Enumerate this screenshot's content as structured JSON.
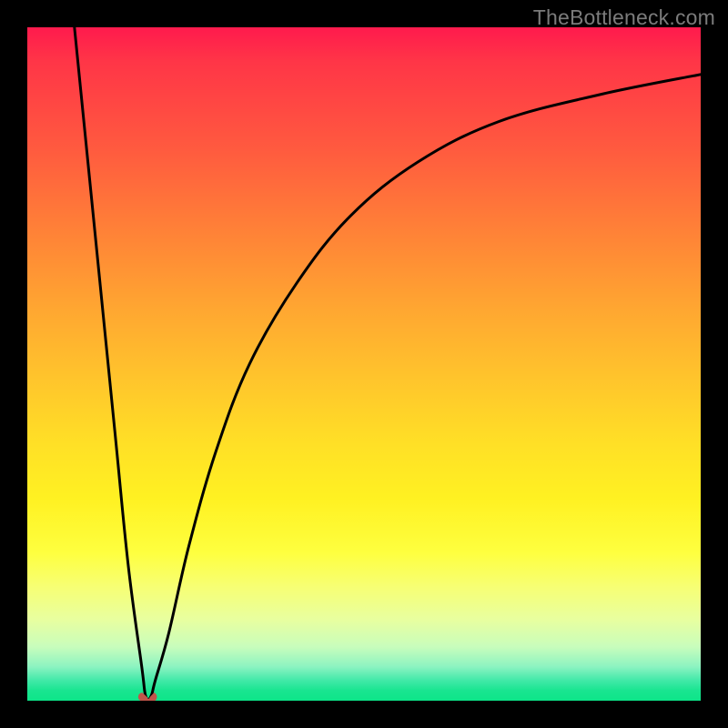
{
  "watermark": {
    "text": "TheBottleneck.com"
  },
  "chart_data": {
    "type": "line",
    "title": "",
    "xlabel": "",
    "ylabel": "",
    "xlim": [
      0,
      100
    ],
    "ylim": [
      0,
      100
    ],
    "grid": false,
    "legend": false,
    "background_gradient": {
      "direction": "vertical",
      "top_color": "#ff1a4d",
      "bottom_color": "#0de589",
      "description": "red (top, high bottleneck) through orange and yellow to green (bottom, low bottleneck)"
    },
    "series": [
      {
        "name": "bottleneck-curve",
        "description": "V-shaped bottleneck curve: left branch falls steeply from top-left to a minimum near x≈18, y≈0; right branch rises concavely toward the upper right.",
        "x": [
          7,
          10,
          13,
          15,
          17,
          17.5,
          18,
          18.5,
          19,
          21,
          24,
          28,
          33,
          40,
          48,
          58,
          70,
          85,
          100
        ],
        "y": [
          100,
          70,
          40,
          20,
          5,
          1,
          0,
          1,
          3,
          10,
          23,
          37,
          50,
          62,
          72,
          80,
          86,
          90,
          93
        ]
      }
    ],
    "minimum_marker": {
      "x": 18,
      "y": 0,
      "color": "#c1554a",
      "shape": "u-blob"
    }
  }
}
